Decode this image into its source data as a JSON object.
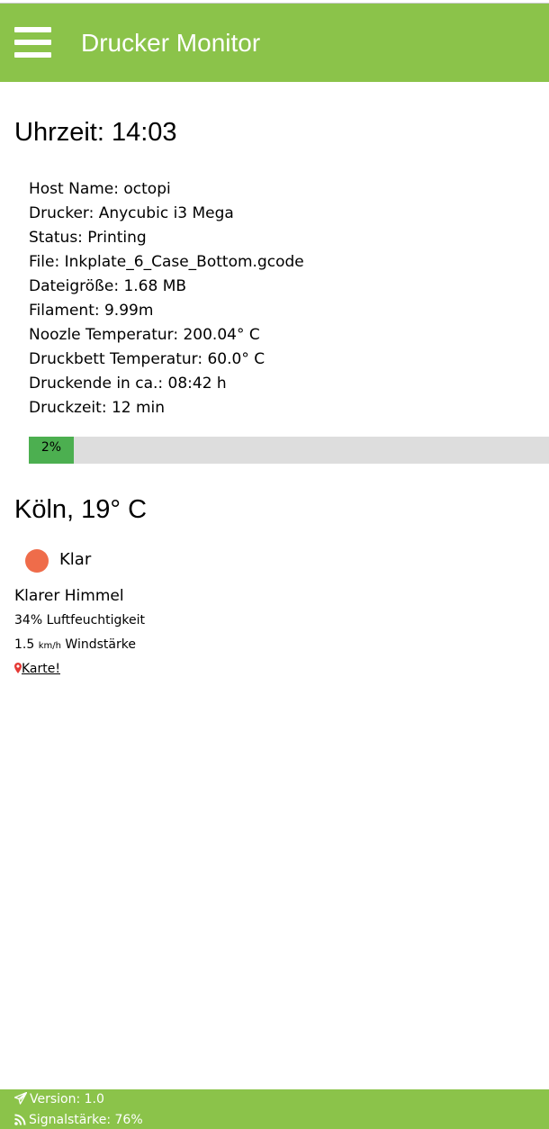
{
  "app": {
    "title": "Drucker Monitor",
    "menu_icon": "hamburger-menu-icon"
  },
  "time": {
    "label": "Uhrzeit: 14:03"
  },
  "printer": {
    "lines": [
      "Host Name: octopi",
      "Drucker: Anycubic i3 Mega",
      "Status: Printing",
      "File: Inkplate_6_Case_Bottom.gcode",
      "Dateigröße: 1.68 MB",
      "Filament: 9.99m",
      "Noozle Temperatur: 200.04° C",
      "Druckbett Temperatur: 60.0° C",
      "Druckende in ca.: 08:42 h",
      "Druckzeit: 12 min"
    ],
    "progress_value": 2,
    "progress_label": "2%"
  },
  "weather": {
    "heading": "Köln, 19° C",
    "condition": "Klar",
    "description": "Klarer Himmel",
    "humidity": "34% Luftfeuchtigkeit",
    "wind_value": "1.5",
    "wind_unit": "km/h",
    "wind_label": "Windstärke",
    "map_link": "Karte!",
    "icon": "sun-icon",
    "map_icon": "map-marker-icon"
  },
  "footer": {
    "version": "Version: 1.0",
    "signal": "Signalstärke: 76%",
    "version_icon": "paper-plane-icon",
    "signal_icon": "rss-signal-icon"
  },
  "colors": {
    "accent": "#8bc34a",
    "progress_fill": "#4caf50",
    "progress_track": "#dddddd",
    "weather_icon": "#ef6c4a",
    "map_marker": "#e53935"
  }
}
